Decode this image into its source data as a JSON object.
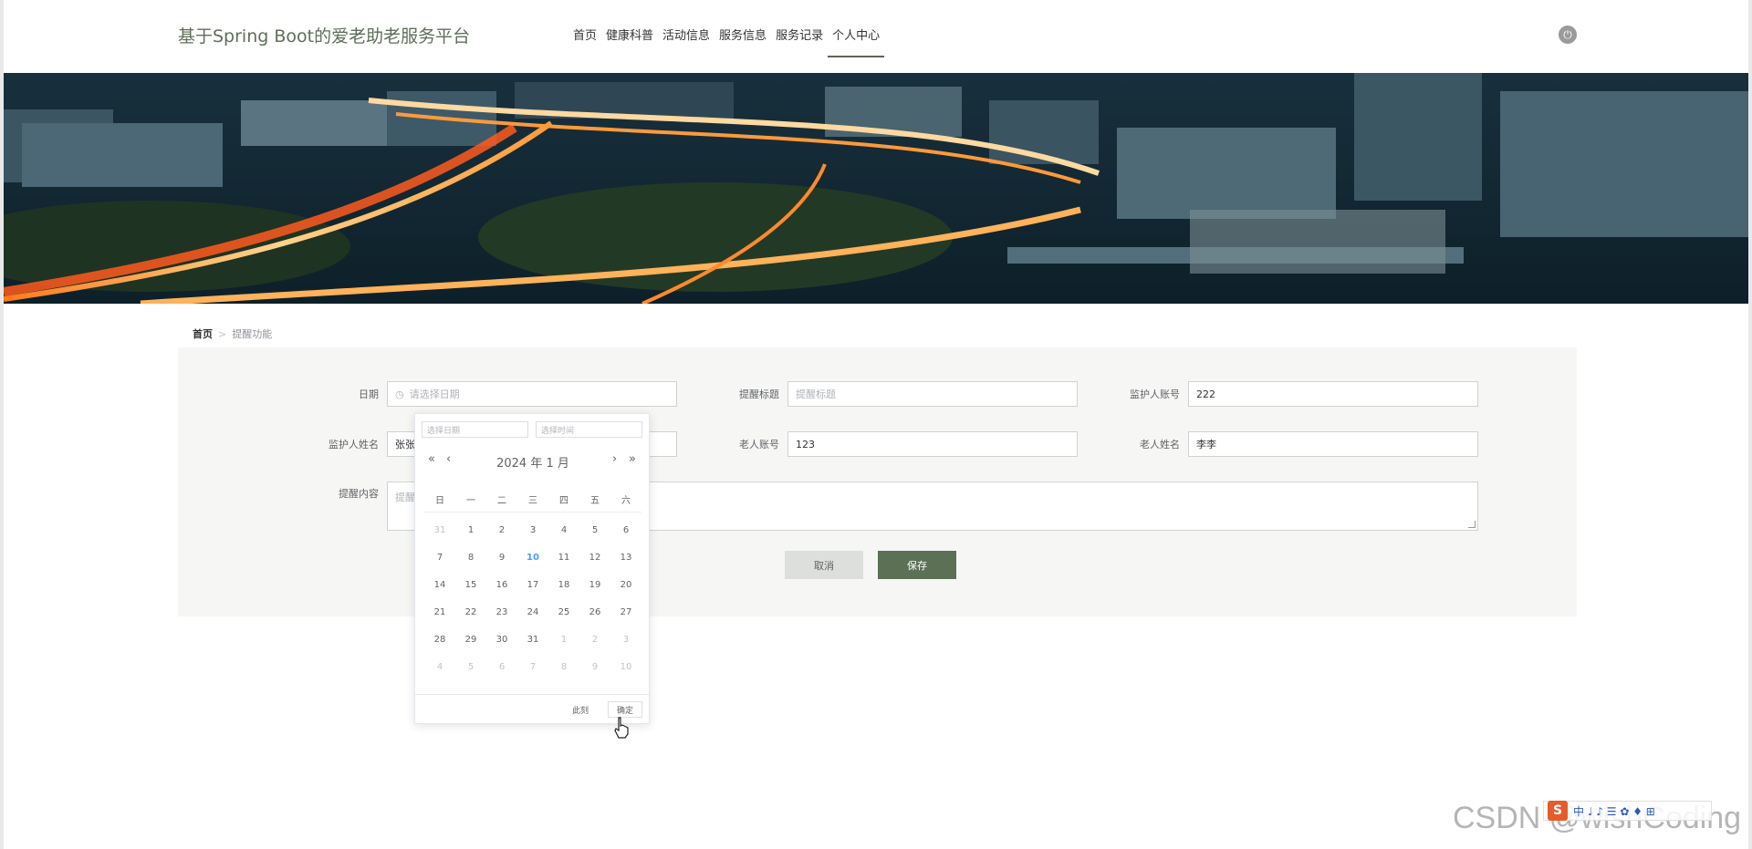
{
  "header": {
    "site_title": "基于Spring Boot的爱老助老服务平台",
    "nav": [
      "首页",
      "健康科普",
      "活动信息",
      "服务信息",
      "服务记录",
      "个人中心"
    ],
    "active_nav": "个人中心"
  },
  "breadcrumb": {
    "home": "首页",
    "separator": ">",
    "current": "提醒功能"
  },
  "form": {
    "date_label": "日期",
    "date_placeholder": "请选择日期",
    "title_label": "提醒标题",
    "title_placeholder": "提醒标题",
    "guardian_account_label": "监护人账号",
    "guardian_account_value": "222",
    "guardian_name_label": "监护人姓名",
    "guardian_name_value": "张张",
    "elder_account_label": "老人账号",
    "elder_account_value": "123",
    "elder_name_label": "老人姓名",
    "elder_name_value": "李李",
    "content_label": "提醒内容",
    "content_placeholder": "提醒内容",
    "cancel_label": "取消",
    "save_label": "保存"
  },
  "datepicker": {
    "date_placeholder": "选择日期",
    "time_placeholder": "选择时间",
    "year": "2024",
    "year_suffix": "年",
    "month": "1",
    "month_suffix": "月",
    "prev_year": "«",
    "prev_month": "‹",
    "next_month": "›",
    "next_year": "»",
    "weekdays": [
      "日",
      "一",
      "二",
      "三",
      "四",
      "五",
      "六"
    ],
    "weeks": [
      [
        {
          "d": "31",
          "m": 1
        },
        {
          "d": "1"
        },
        {
          "d": "2"
        },
        {
          "d": "3"
        },
        {
          "d": "4"
        },
        {
          "d": "5"
        },
        {
          "d": "6"
        }
      ],
      [
        {
          "d": "7"
        },
        {
          "d": "8"
        },
        {
          "d": "9"
        },
        {
          "d": "10",
          "t": 1
        },
        {
          "d": "11"
        },
        {
          "d": "12"
        },
        {
          "d": "13"
        }
      ],
      [
        {
          "d": "14"
        },
        {
          "d": "15"
        },
        {
          "d": "16"
        },
        {
          "d": "17"
        },
        {
          "d": "18"
        },
        {
          "d": "19"
        },
        {
          "d": "20"
        }
      ],
      [
        {
          "d": "21"
        },
        {
          "d": "22"
        },
        {
          "d": "23"
        },
        {
          "d": "24"
        },
        {
          "d": "25"
        },
        {
          "d": "26"
        },
        {
          "d": "27"
        }
      ],
      [
        {
          "d": "28"
        },
        {
          "d": "29"
        },
        {
          "d": "30"
        },
        {
          "d": "31"
        },
        {
          "d": "1",
          "m": 1
        },
        {
          "d": "2",
          "m": 1
        },
        {
          "d": "3",
          "m": 1
        }
      ],
      [
        {
          "d": "4",
          "m": 1
        },
        {
          "d": "5",
          "m": 1
        },
        {
          "d": "6",
          "m": 1
        },
        {
          "d": "7",
          "m": 1
        },
        {
          "d": "8",
          "m": 1
        },
        {
          "d": "9",
          "m": 1
        },
        {
          "d": "10",
          "m": 1
        }
      ]
    ],
    "now_label": "此刻",
    "ok_label": "确定"
  },
  "ime": {
    "logo": "S",
    "text": "中 ♩ ♪ ☰ ✿ ♦ ⊞"
  },
  "watermark": "CSDN @wishCoding",
  "colors": {
    "accent": "#5b7055",
    "today": "#409eff",
    "panel_bg": "#f6f7f5"
  }
}
